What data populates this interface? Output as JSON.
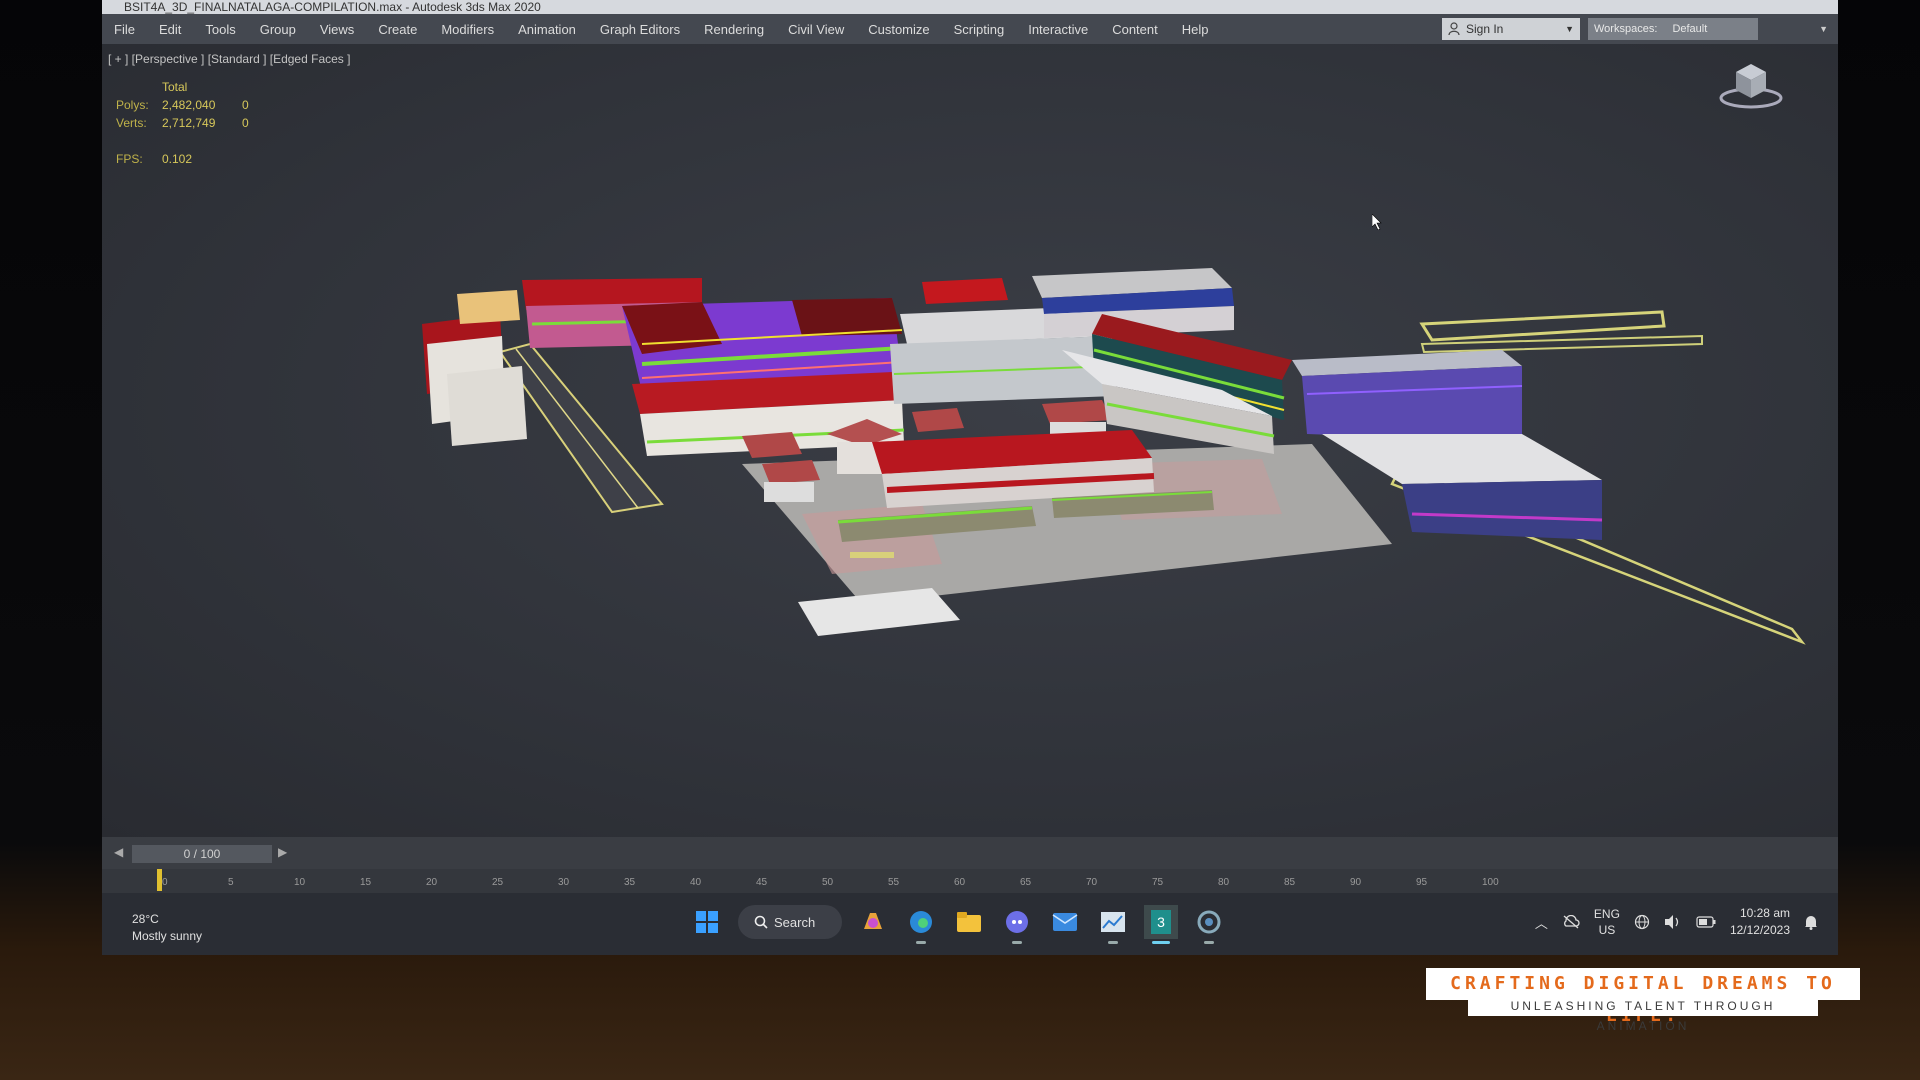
{
  "window": {
    "title": "BSIT4A_3D_FINALNATALAGA-COMPILATION.max - Autodesk 3ds Max 2020"
  },
  "menu": {
    "items": [
      "File",
      "Edit",
      "Tools",
      "Group",
      "Views",
      "Create",
      "Modifiers",
      "Animation",
      "Graph Editors",
      "Rendering",
      "Civil View",
      "Customize",
      "Scripting",
      "Interactive",
      "Content",
      "Help"
    ],
    "sign_in": "Sign In",
    "workspaces_label": "Workspaces:",
    "workspaces_value": "Default"
  },
  "viewport": {
    "label": "[ + ] [Perspective ] [Standard ] [Edged Faces ]",
    "stats": {
      "header": "Total",
      "polys_label": "Polys:",
      "polys_total": "2,482,040",
      "polys_sel": "0",
      "verts_label": "Verts:",
      "verts_total": "2,712,749",
      "verts_sel": "0",
      "fps_label": "FPS:",
      "fps_value": "0.102"
    }
  },
  "timeline": {
    "slider_text": "0 / 100",
    "ticks": [
      "0",
      "5",
      "10",
      "15",
      "20",
      "25",
      "30",
      "35",
      "40",
      "45",
      "50",
      "55",
      "60",
      "65",
      "70",
      "75",
      "80",
      "85",
      "90",
      "95",
      "100"
    ]
  },
  "taskbar": {
    "weather_temp": "28°C",
    "weather_desc": "Mostly sunny",
    "search_label": "Search",
    "lang_line1": "ENG",
    "lang_line2": "US",
    "time": "10:28 am",
    "date": "12/12/2023"
  },
  "banner": {
    "title": "CRAFTING DIGITAL DREAMS TO LIFE:",
    "subtitle": "UNLEASHING TALENT THROUGH ANIMATION"
  },
  "colors": {
    "roof_red": "#b01c22",
    "roof_blue": "#2d3f9c",
    "wire_green": "#7adc3a",
    "wire_magenta": "#c23ac9",
    "banner_orange": "#e46a1c"
  }
}
